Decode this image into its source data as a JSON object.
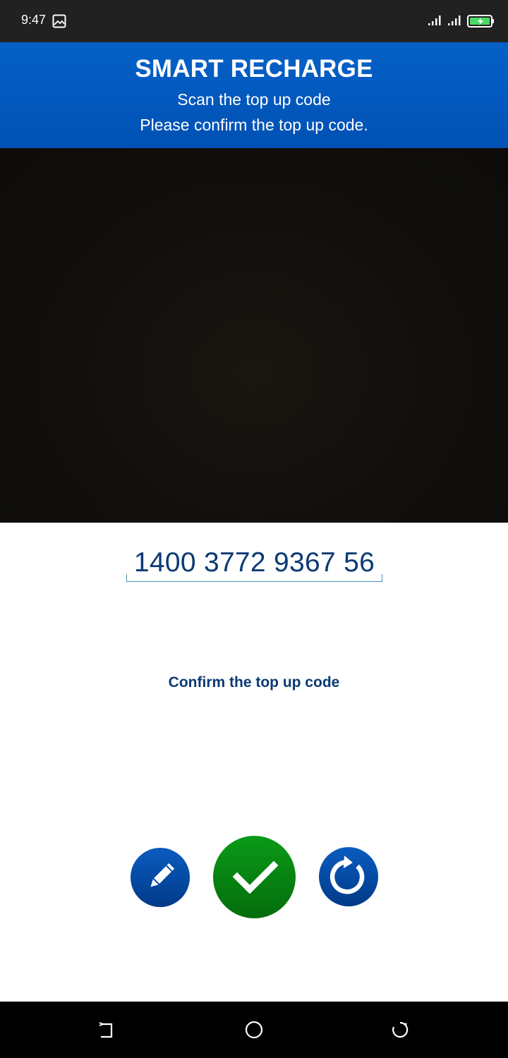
{
  "status_bar": {
    "time": "9:47",
    "icons": [
      "gallery-icon",
      "signal-icon",
      "signal-icon",
      "battery-charging-icon"
    ],
    "battery_color": "#4cd964"
  },
  "header": {
    "title": "SMART RECHARGE",
    "subtitle": "Scan the top up code",
    "instruction": "Please confirm the top up code.",
    "background_color": "#0558c0"
  },
  "camera": {
    "state": "preview"
  },
  "code_field": {
    "value": "1400 3772 9367 56"
  },
  "confirm_label": "Confirm the top up code",
  "actions": {
    "edit_icon": "pencil-icon",
    "confirm_icon": "checkmark-icon",
    "refresh_icon": "refresh-icon",
    "primary_color": "#008a12",
    "secondary_color": "#0a4da6"
  },
  "nav_bar": {
    "icons": [
      "back-icon",
      "home-icon",
      "recent-apps-icon"
    ]
  }
}
